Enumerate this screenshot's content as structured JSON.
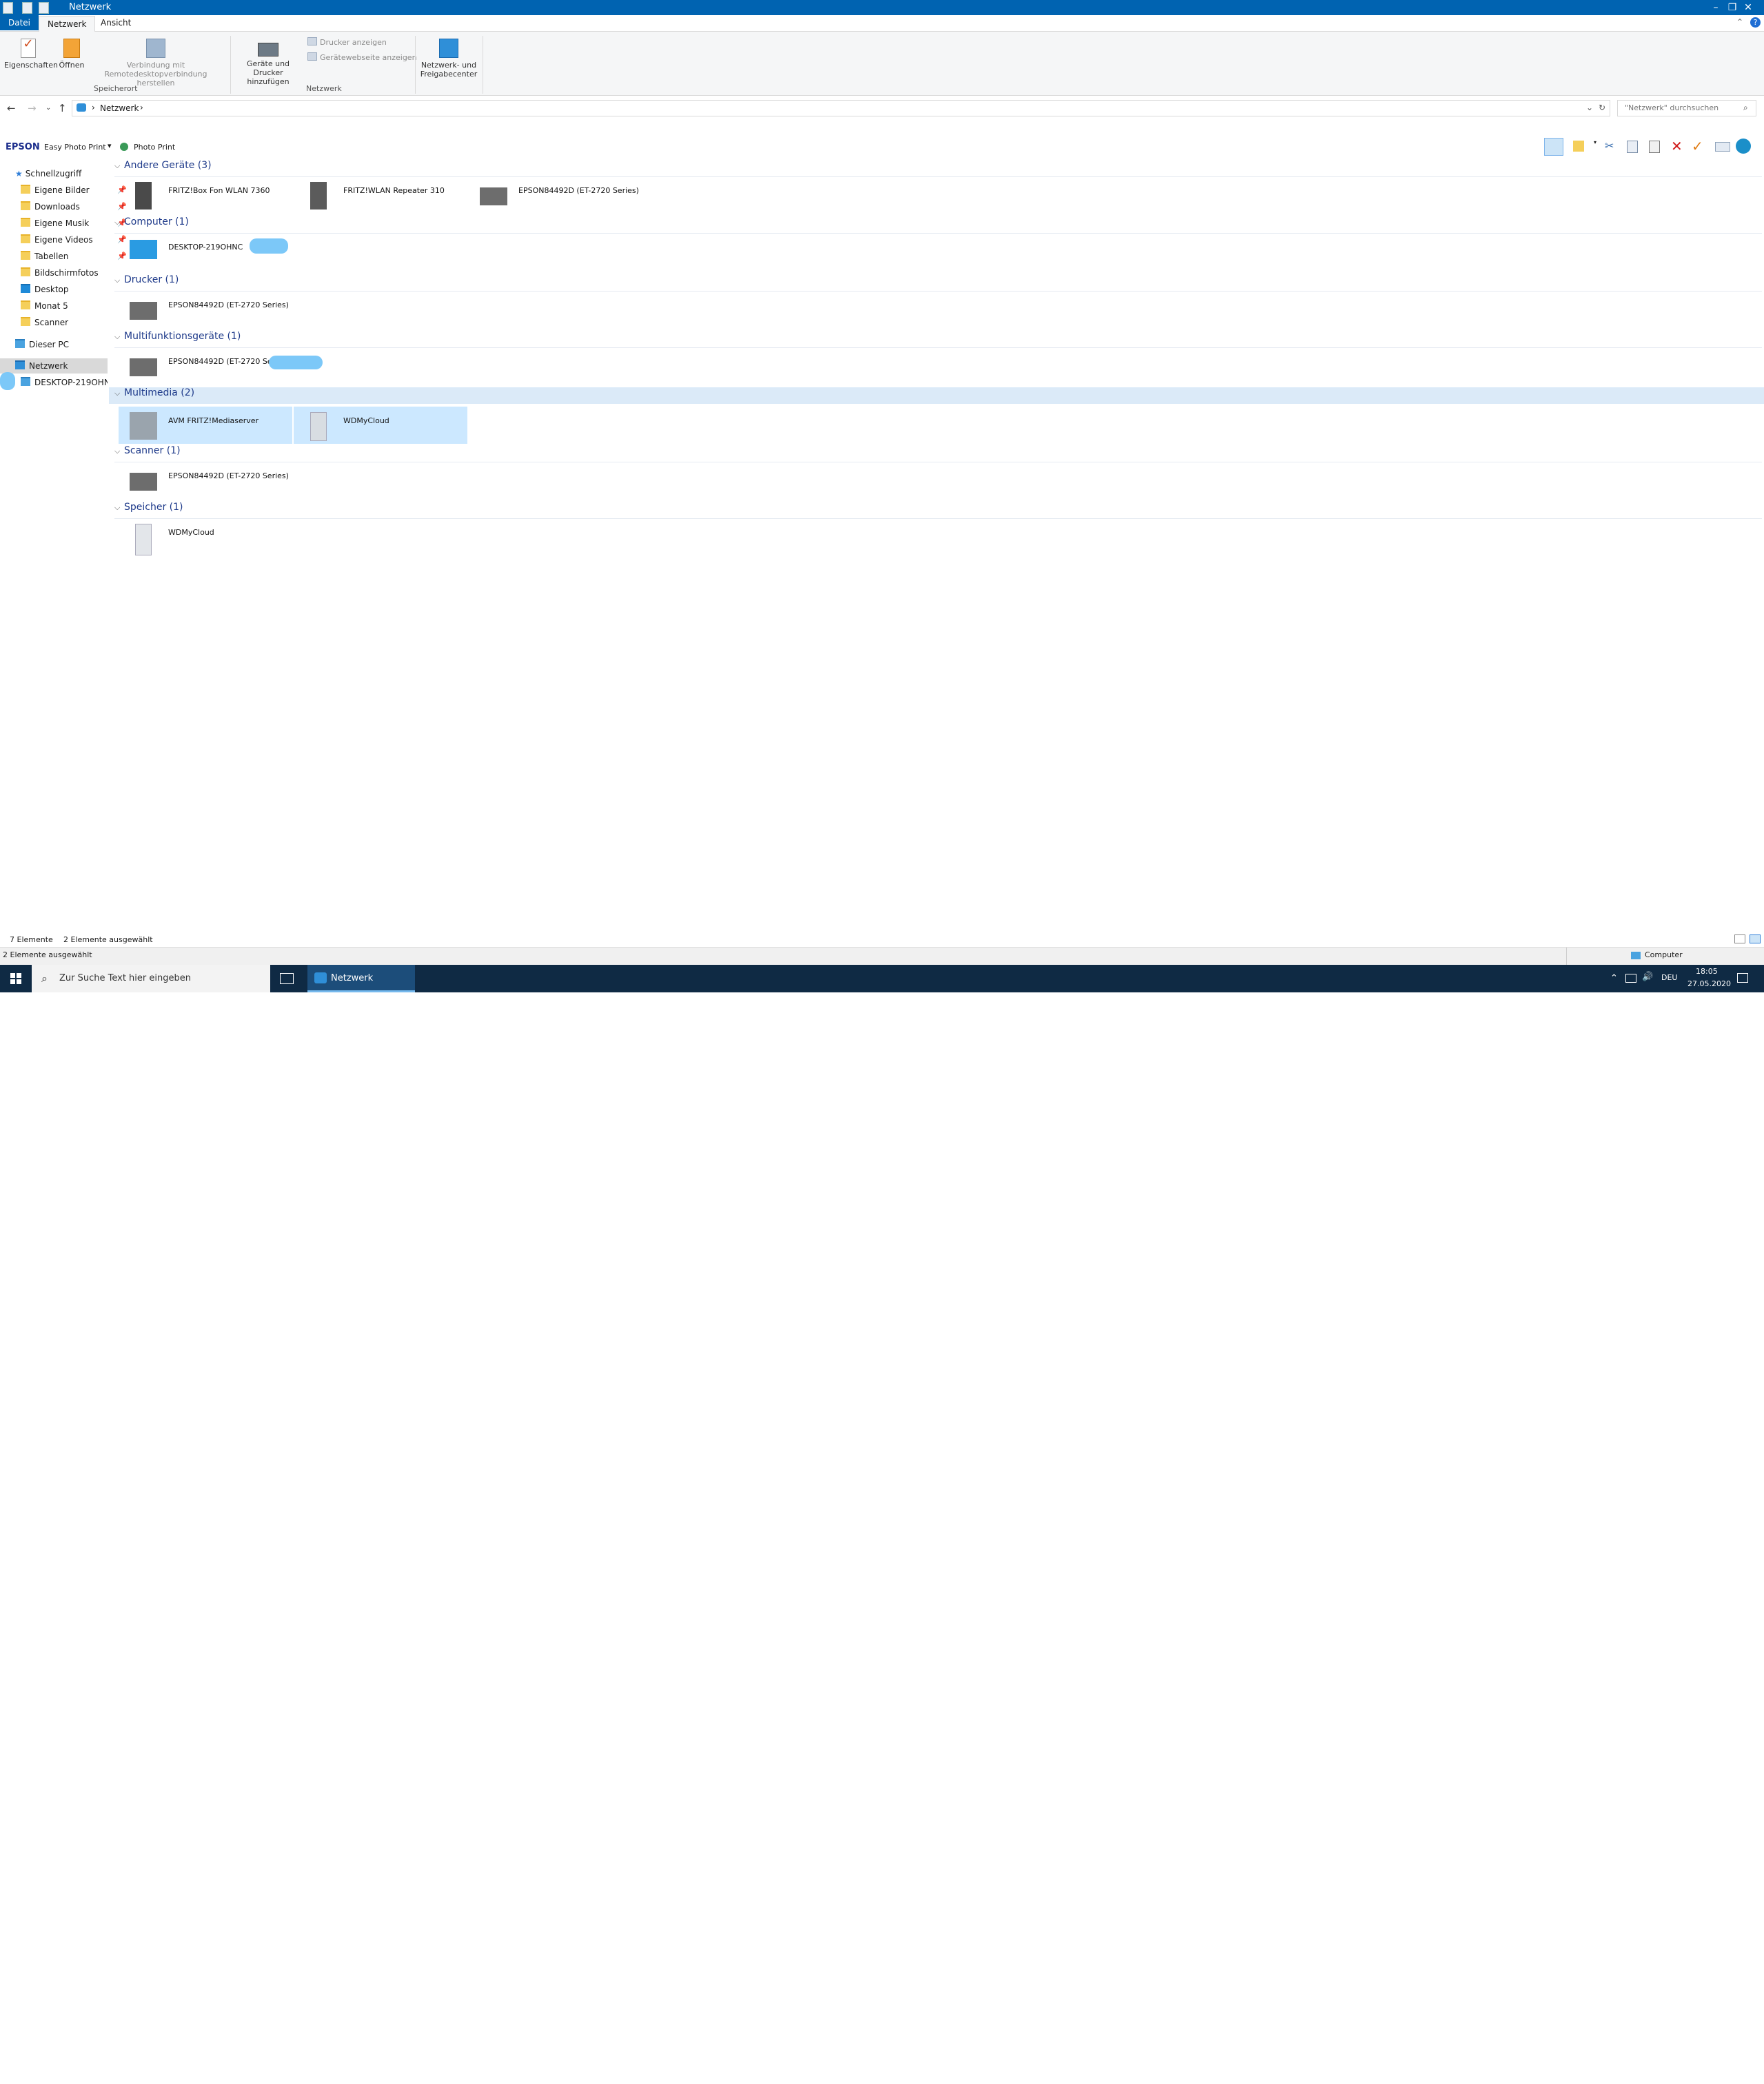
{
  "window": {
    "title": "Netzwerk"
  },
  "ribbon": {
    "tabs": [
      "Datei",
      "Netzwerk",
      "Ansicht"
    ],
    "buttons": {
      "properties": "Eigenschaften",
      "open": "Öffnen",
      "remote_line1": "Verbindung mit",
      "remote_line2": "Remotedesktopverbindung herstellen",
      "add_devices_line1": "Geräte und Drucker",
      "add_devices_line2": "hinzufügen",
      "show_printers": "Drucker anzeigen",
      "device_webpage": "Gerätewebseite anzeigen",
      "network_center_line1": "Netzwerk- und",
      "network_center_line2": "Freigabecenter"
    },
    "groups": [
      "Speicherort",
      "Netzwerk"
    ]
  },
  "address": {
    "path": "Netzwerk",
    "search_placeholder": "\"Netzwerk\" durchsuchen"
  },
  "epson_toolbar": {
    "brand": "EPSON",
    "app": "Easy Photo Print",
    "photo_print": "Photo Print"
  },
  "nav": {
    "quick_access": "Schnellzugriff",
    "items": [
      "Eigene Bilder",
      "Downloads",
      "Eigene Musik",
      "Eigene Videos",
      "Tabellen",
      "Bildschirmfotos",
      "Desktop",
      "Monat 5",
      "Scanner"
    ],
    "this_pc": "Dieser PC",
    "network": "Netzwerk",
    "desktop_host": "DESKTOP-219OHNC"
  },
  "groups": [
    {
      "title": "Andere Geräte (3)",
      "items": [
        "FRITZ!Box Fon WLAN 7360",
        "FRITZ!WLAN Repeater 310",
        "EPSON84492D (ET-2720 Series)"
      ]
    },
    {
      "title": "Computer (1)",
      "items": [
        "DESKTOP-219OHNC"
      ]
    },
    {
      "title": "Drucker (1)",
      "items": [
        "EPSON84492D (ET-2720 Series)"
      ]
    },
    {
      "title": "Multifunktionsgeräte (1)",
      "items": [
        "EPSON84492D (ET-2720 Series)"
      ]
    },
    {
      "title": "Multimedia (2)",
      "items": [
        "AVM FRITZ!Mediaserver",
        "WDMyCloud"
      ]
    },
    {
      "title": "Scanner (1)",
      "items": [
        "EPSON84492D (ET-2720 Series)"
      ]
    },
    {
      "title": "Speicher (1)",
      "items": [
        "WDMyCloud"
      ]
    }
  ],
  "status": {
    "count": "7 Elemente",
    "selected": "2 Elemente ausgewählt",
    "bottom_left": "2 Elemente ausgewählt",
    "bottom_right": "Computer"
  },
  "taskbar": {
    "search": "Zur Suche Text hier eingeben",
    "app": "Netzwerk",
    "lang": "DEU",
    "time": "18:05",
    "date": "27.05.2020"
  },
  "colors": {
    "accent": "#0063b1",
    "selection": "#cce8ff",
    "group_title": "#1e3a8a",
    "taskbar": "#0f2a44"
  }
}
